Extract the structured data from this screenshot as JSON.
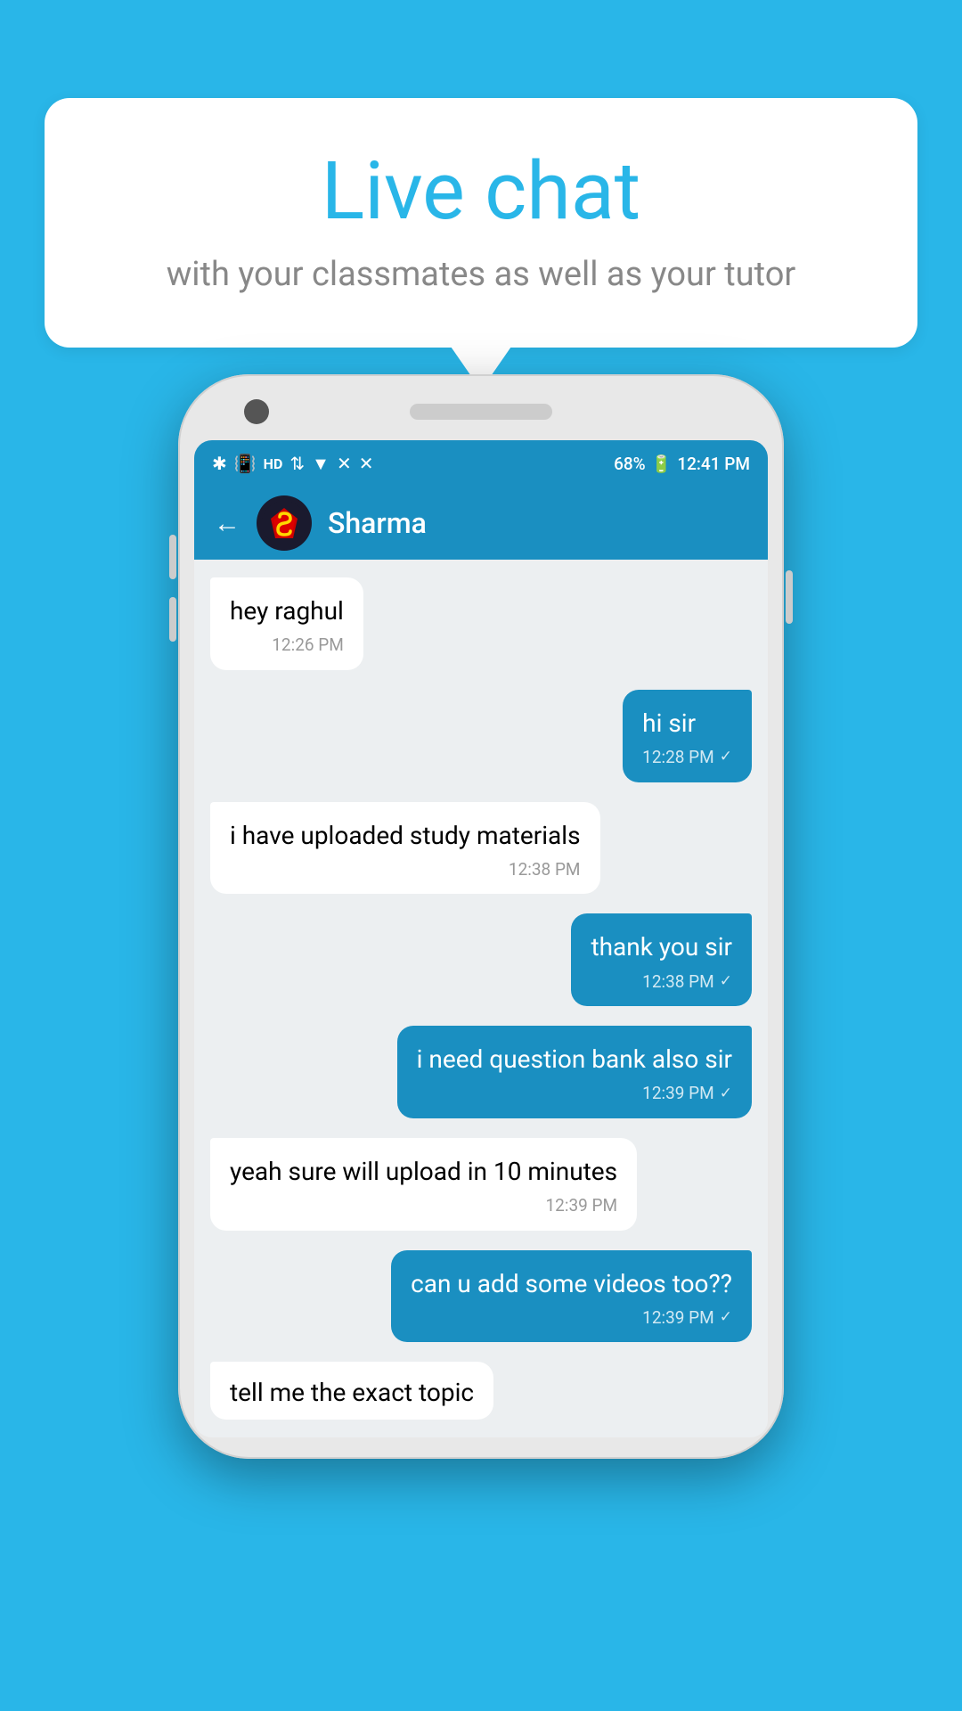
{
  "background_color": "#29b6e8",
  "speech_bubble": {
    "title": "Live chat",
    "subtitle": "with your classmates as well as your tutor"
  },
  "phone": {
    "status_bar": {
      "time": "12:41 PM",
      "battery": "68%",
      "signal_icons": "🔷 📳 HD ▲▼ 📶 ✕ 📵"
    },
    "chat_header": {
      "back_label": "←",
      "contact_name": "Sharma"
    },
    "messages": [
      {
        "id": 1,
        "type": "received",
        "text": "hey raghul",
        "time": "12:26 PM",
        "show_check": false
      },
      {
        "id": 2,
        "type": "sent",
        "text": "hi sir",
        "time": "12:28 PM",
        "show_check": true
      },
      {
        "id": 3,
        "type": "received",
        "text": "i have uploaded study materials",
        "time": "12:38 PM",
        "show_check": false
      },
      {
        "id": 4,
        "type": "sent",
        "text": "thank you sir",
        "time": "12:38 PM",
        "show_check": true
      },
      {
        "id": 5,
        "type": "sent",
        "text": "i need question bank also sir",
        "time": "12:39 PM",
        "show_check": true
      },
      {
        "id": 6,
        "type": "received",
        "text": "yeah sure will upload in 10 minutes",
        "time": "12:39 PM",
        "show_check": false
      },
      {
        "id": 7,
        "type": "sent",
        "text": "can u add some videos too??",
        "time": "12:39 PM",
        "show_check": true
      },
      {
        "id": 8,
        "type": "received",
        "text": "tell me the exact topic",
        "time": "",
        "show_check": false,
        "partial": true
      }
    ]
  }
}
